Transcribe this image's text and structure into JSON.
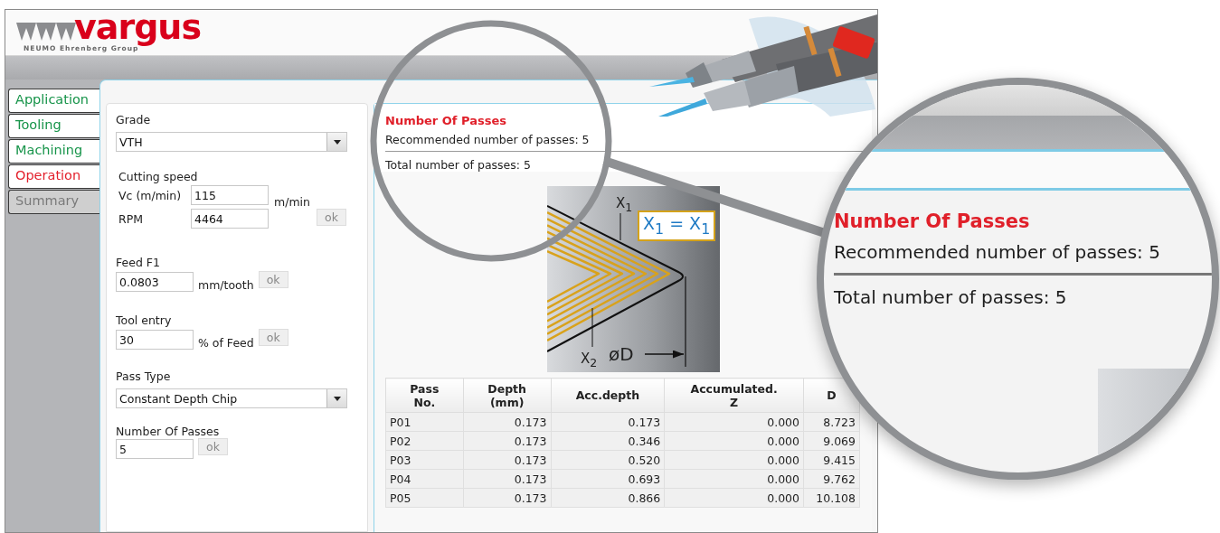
{
  "header": {
    "logo_name": "vargus",
    "logo_tagline": "NEUMO Ehrenberg Group"
  },
  "nav_tabs": [
    {
      "label": "Application",
      "selected": false,
      "disabled": false
    },
    {
      "label": "Tooling",
      "selected": false,
      "disabled": false
    },
    {
      "label": "Machining",
      "selected": false,
      "disabled": false
    },
    {
      "label": "Operation",
      "selected": true,
      "disabled": false
    },
    {
      "label": "Summary",
      "selected": false,
      "disabled": true
    }
  ],
  "form": {
    "grade": {
      "label": "Grade",
      "value": "VTH"
    },
    "cutting_speed": {
      "label": "Cutting speed",
      "vc_label": "Vc (m/min)",
      "vc_value": "115",
      "vc_unit": "m/min",
      "rpm_label": "RPM",
      "rpm_value": "4464",
      "button": "ok"
    },
    "feed": {
      "label": "Feed F1",
      "value": "0.0803",
      "unit": "mm/tooth",
      "button": "ok"
    },
    "tool_entry": {
      "label": "Tool entry",
      "value": "30",
      "unit": "% of Feed",
      "button": "ok"
    },
    "pass_type": {
      "label": "Pass Type",
      "value": "Constant Depth Chip"
    },
    "number_of_passes": {
      "label": "Number Of Passes",
      "value": "5",
      "button": "ok"
    }
  },
  "result": {
    "title": "Number Of Passes",
    "recommended": "Recommended number of passes: 5",
    "total": "Total number of passes: 5",
    "diagram": {
      "x1_label": "X$_{1}$",
      "equation": "X$_{1}$ = X$_{1}$",
      "x2_label": "X$_{2}$",
      "diameter_label": "øD"
    }
  },
  "table": {
    "columns": [
      "Pass\nNo.",
      "Depth\n(mm)",
      "Acc.depth",
      "Accumulated.\nZ",
      "D"
    ],
    "rows": [
      [
        "P01",
        "0.173",
        "0.173",
        "0.000",
        "8.723"
      ],
      [
        "P02",
        "0.173",
        "0.346",
        "0.000",
        "9.069"
      ],
      [
        "P03",
        "0.173",
        "0.520",
        "0.000",
        "9.415"
      ],
      [
        "P04",
        "0.173",
        "0.693",
        "0.000",
        "9.762"
      ],
      [
        "P05",
        "0.173",
        "0.866",
        "0.000",
        "10.108"
      ]
    ]
  },
  "magnifier": {
    "title": "Number Of Passes",
    "recommended": "Recommended number of passes: 5",
    "total": "Total number of passes: 5"
  }
}
